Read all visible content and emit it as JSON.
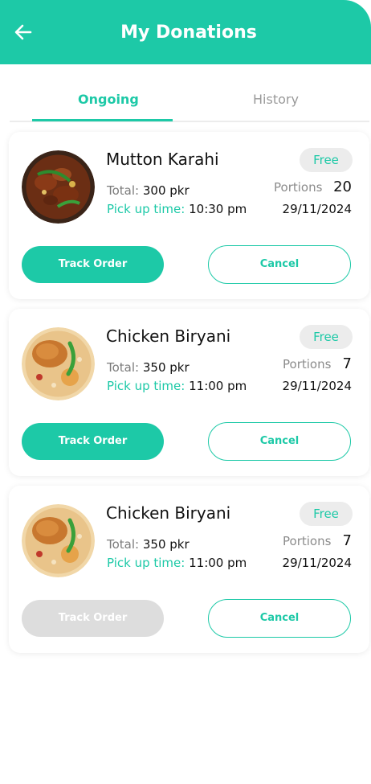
{
  "header": {
    "title": "My Donations",
    "back_icon": "arrow-left-icon"
  },
  "tabs": [
    {
      "label": "Ongoing",
      "active": true
    },
    {
      "label": "History",
      "active": false
    }
  ],
  "labels": {
    "total": "Total:",
    "pickup": "Pick up time:",
    "portions": "Portions",
    "track": "Track Order",
    "cancel": "Cancel"
  },
  "cards": [
    {
      "name": "Mutton Karahi",
      "badge": "Free",
      "total": "300 pkr",
      "pickup_time": "10:30 pm",
      "portions": "20",
      "date": "29/11/2024",
      "track_enabled": true
    },
    {
      "name": "Chicken Biryani",
      "badge": "Free",
      "total": "350 pkr",
      "pickup_time": "11:00 pm",
      "portions": "7",
      "date": "29/11/2024",
      "track_enabled": true
    },
    {
      "name": "Chicken Biryani",
      "badge": "Free",
      "total": "350 pkr",
      "pickup_time": "11:00 pm",
      "portions": "7",
      "date": "29/11/2024",
      "track_enabled": false
    }
  ],
  "colors": {
    "accent": "#1dc9a7",
    "disabled": "#dddddd"
  }
}
